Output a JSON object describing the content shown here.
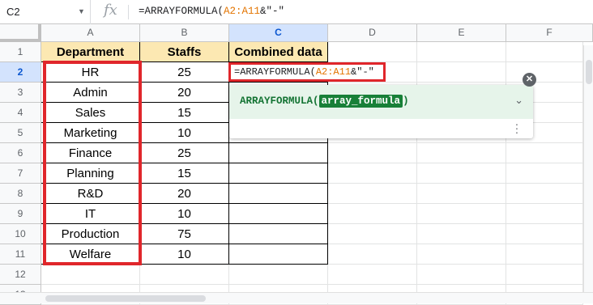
{
  "formula_bar": {
    "name_box": "C2",
    "fx": "fx",
    "formula_prefix": "=ARRAYFORMULA(",
    "formula_ref": "A2:A11",
    "formula_suffix": "&\"-\""
  },
  "columns": [
    "A",
    "B",
    "C",
    "D",
    "E",
    "F"
  ],
  "rows": [
    "1",
    "2",
    "3",
    "4",
    "5",
    "6",
    "7",
    "8",
    "9",
    "10",
    "11",
    "12",
    "13"
  ],
  "sheet": {
    "headers": {
      "a": "Department",
      "b": "Staffs",
      "c": "Combined data"
    },
    "departments": [
      "HR",
      "Admin",
      "Sales",
      "Marketing",
      "Finance",
      "Planning",
      "R&D",
      "IT",
      "Production",
      "Welfare"
    ],
    "staffs": [
      "25",
      "20",
      "15",
      "10",
      "25",
      "15",
      "20",
      "10",
      "75",
      "10"
    ]
  },
  "cell_editor": {
    "prefix": "=ARRAYFORMULA(",
    "ref": "A2:A11",
    "suffix": "&\"-\""
  },
  "popup": {
    "function_name": "ARRAYFORMULA(",
    "argument": "array_formula",
    "close_paren": ")"
  },
  "colors": {
    "header_fill": "#fce8b2",
    "highlight_red": "#e0262b",
    "popup_fill": "#e6f4ea",
    "ref_orange": "#e37400"
  }
}
